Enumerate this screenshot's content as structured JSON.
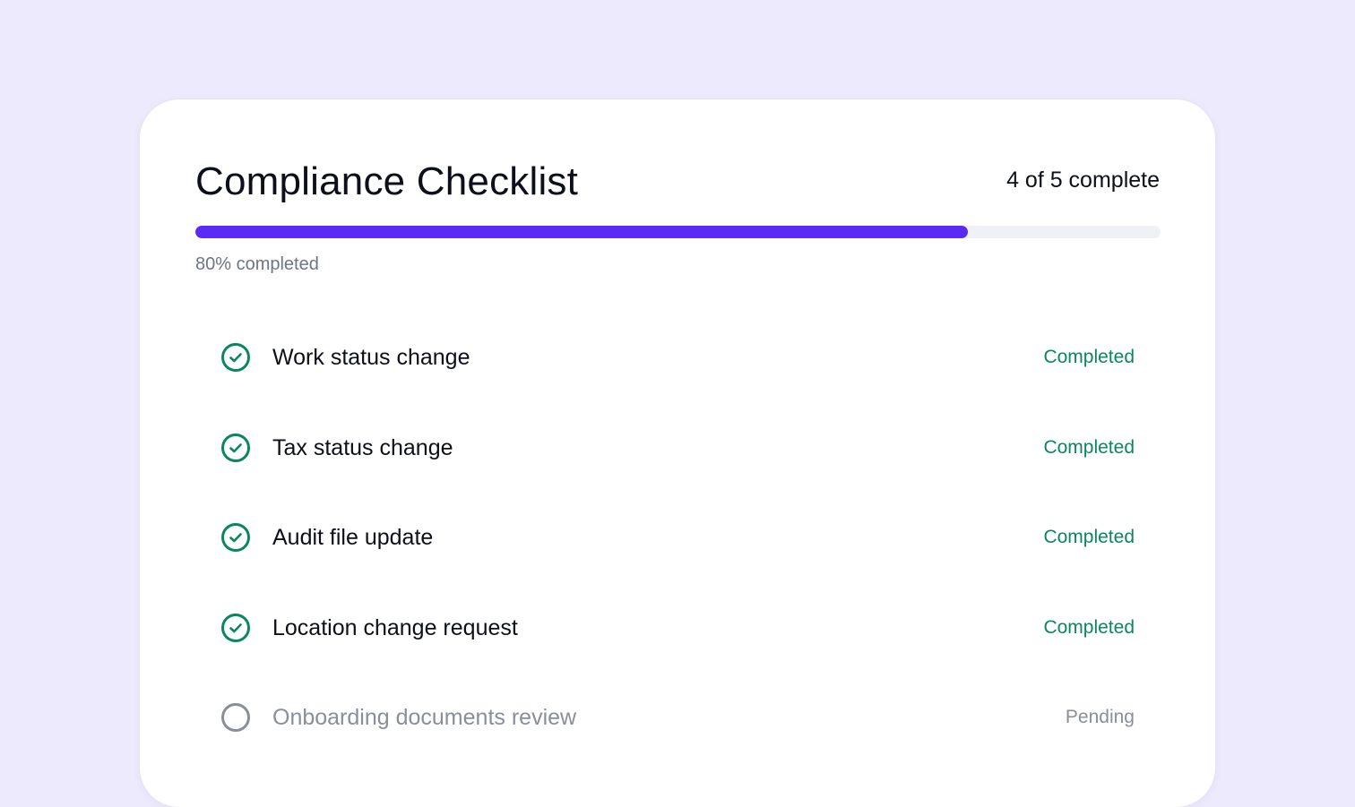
{
  "checklist": {
    "title": "Compliance Checklist",
    "count_text": "4 of 5 complete",
    "progress_fraction": 0.8,
    "progress_label": "80% completed",
    "items": [
      {
        "label": "Work status change",
        "status": "Completed",
        "state": "done",
        "icon": "check-circle-icon"
      },
      {
        "label": "Tax status change",
        "status": "Completed",
        "state": "done",
        "icon": "check-circle-icon"
      },
      {
        "label": "Audit file update",
        "status": "Completed",
        "state": "done",
        "icon": "check-circle-icon"
      },
      {
        "label": "Location change request",
        "status": "Completed",
        "state": "done",
        "icon": "check-circle-icon"
      },
      {
        "label": "Onboarding documents review",
        "status": "Pending",
        "state": "pending",
        "icon": "empty-circle-icon"
      }
    ]
  },
  "colors": {
    "background": "#edeafd",
    "accent": "#5b2af7",
    "completed": "#0a875e",
    "pending": "#8a8e9a"
  }
}
